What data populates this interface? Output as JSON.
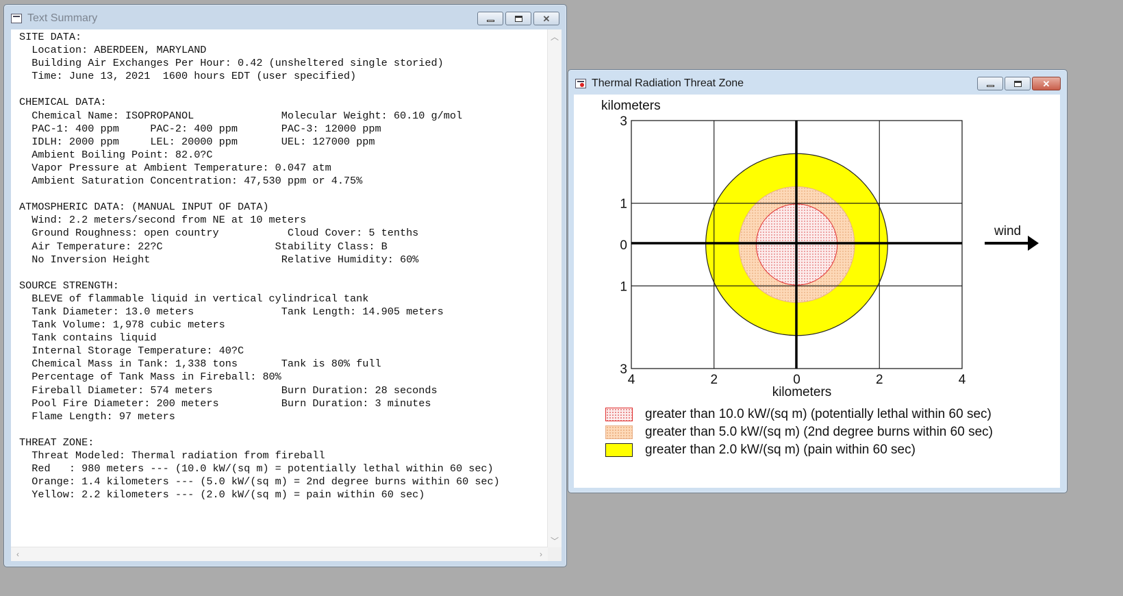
{
  "text_window": {
    "title": "Text Summary",
    "report_lines": [
      "SITE DATA:",
      "  Location: ABERDEEN, MARYLAND",
      "  Building Air Exchanges Per Hour: 0.42 (unsheltered single storied)",
      "  Time: June 13, 2021  1600 hours EDT (user specified)",
      "",
      "CHEMICAL DATA:",
      "  Chemical Name: ISOPROPANOL              Molecular Weight: 60.10 g/mol",
      "  PAC-1: 400 ppm     PAC-2: 400 ppm       PAC-3: 12000 ppm",
      "  IDLH: 2000 ppm     LEL: 20000 ppm       UEL: 127000 ppm",
      "  Ambient Boiling Point: 82.0?C",
      "  Vapor Pressure at Ambient Temperature: 0.047 atm",
      "  Ambient Saturation Concentration: 47,530 ppm or 4.75%",
      "",
      "ATMOSPHERIC DATA: (MANUAL INPUT OF DATA)",
      "  Wind: 2.2 meters/second from NE at 10 meters",
      "  Ground Roughness: open country           Cloud Cover: 5 tenths",
      "  Air Temperature: 22?C                  Stability Class: B",
      "  No Inversion Height                     Relative Humidity: 60%",
      "",
      "SOURCE STRENGTH:",
      "  BLEVE of flammable liquid in vertical cylindrical tank",
      "  Tank Diameter: 13.0 meters              Tank Length: 14.905 meters",
      "  Tank Volume: 1,978 cubic meters",
      "  Tank contains liquid",
      "  Internal Storage Temperature: 40?C",
      "  Chemical Mass in Tank: 1,338 tons       Tank is 80% full",
      "  Percentage of Tank Mass in Fireball: 80%",
      "  Fireball Diameter: 574 meters           Burn Duration: 28 seconds",
      "  Pool Fire Diameter: 200 meters          Burn Duration: 3 minutes",
      "  Flame Length: 97 meters",
      "",
      "THREAT ZONE:",
      "  Threat Modeled: Thermal radiation from fireball",
      "  Red   : 980 meters --- (10.0 kW/(sq m) = potentially lethal within 60 sec)",
      "  Orange: 1.4 kilometers --- (5.0 kW/(sq m) = 2nd degree burns within 60 sec)",
      "  Yellow: 2.2 kilometers --- (2.0 kW/(sq m) = pain within 60 sec)"
    ]
  },
  "plot_window": {
    "title": "Thermal Radiation Threat Zone",
    "y_axis_label": "kilometers",
    "x_axis_label": "kilometers",
    "wind_label": "wind",
    "y_ticks": [
      {
        "value": 3,
        "label": "3"
      },
      {
        "value": 1,
        "label": "1"
      },
      {
        "value": 0,
        "label": "0"
      },
      {
        "value": -1,
        "label": "1"
      },
      {
        "value": -3,
        "label": "3"
      }
    ],
    "x_ticks": [
      {
        "value": -4,
        "label": "4"
      },
      {
        "value": -2,
        "label": "2"
      },
      {
        "value": 0,
        "label": "0"
      },
      {
        "value": 2,
        "label": "2"
      },
      {
        "value": 4,
        "label": "4"
      }
    ],
    "legend": [
      {
        "label": "greater than 10.0 kW/(sq m) (potentially lethal within 60 sec)",
        "fill": "#fcecec",
        "stroke": "#e03030",
        "dots": "#d83030"
      },
      {
        "label": "greater than 5.0 kW/(sq m) (2nd degree burns within 60 sec)",
        "fill": "#fdd9b8",
        "stroke": "#e8b08a",
        "dots": "#e0955f"
      },
      {
        "label": "greater than 2.0 kW/(sq m) (pain within 60 sec)",
        "fill": "#ffff00",
        "stroke": "#222222",
        "dots": ""
      }
    ]
  },
  "chart_data": {
    "type": "scatter",
    "title": "Thermal Radiation Threat Zone",
    "xlabel": "kilometers",
    "ylabel": "kilometers",
    "xlim": [
      -4,
      4
    ],
    "ylim": [
      -3,
      3
    ],
    "grid": true,
    "zones": [
      {
        "color": "yellow",
        "radius_km": 2.2,
        "fill": "#ffff00",
        "stroke": "#222222"
      },
      {
        "color": "orange",
        "radius_km": 1.4,
        "fill": "#fdd9b8",
        "stroke": "#e8b08a"
      },
      {
        "color": "red",
        "radius_km": 0.98,
        "fill": "#fcecec",
        "stroke": "#e03030"
      }
    ]
  }
}
